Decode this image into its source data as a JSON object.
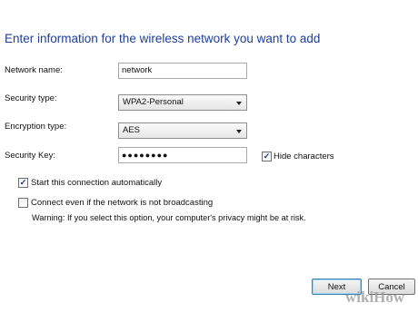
{
  "dialog": {
    "heading": "Enter information for the wireless network you want to add"
  },
  "form": {
    "network_name_label": "Network name:",
    "network_name_value": "network",
    "security_type_label": "Security type:",
    "security_type_value": "WPA2-Personal",
    "encryption_type_label": "Encryption type:",
    "encryption_type_value": "AES",
    "security_key_label": "Security Key:",
    "security_key_value": "●●●●●●●●",
    "hide_characters_label": "Hide characters",
    "hide_characters_checked": true
  },
  "options": {
    "auto_start_label": "Start this connection automatically",
    "auto_start_checked": true,
    "connect_hidden_label": "Connect even if the network is not broadcasting",
    "connect_hidden_checked": false,
    "warning_text": "Warning: If you select this option, your computer's privacy might be at risk."
  },
  "buttons": {
    "next_label": "Next",
    "cancel_label": "Cancel"
  },
  "watermark": {
    "text": "wikiHow"
  },
  "icons": {
    "checkmark": "✓"
  }
}
